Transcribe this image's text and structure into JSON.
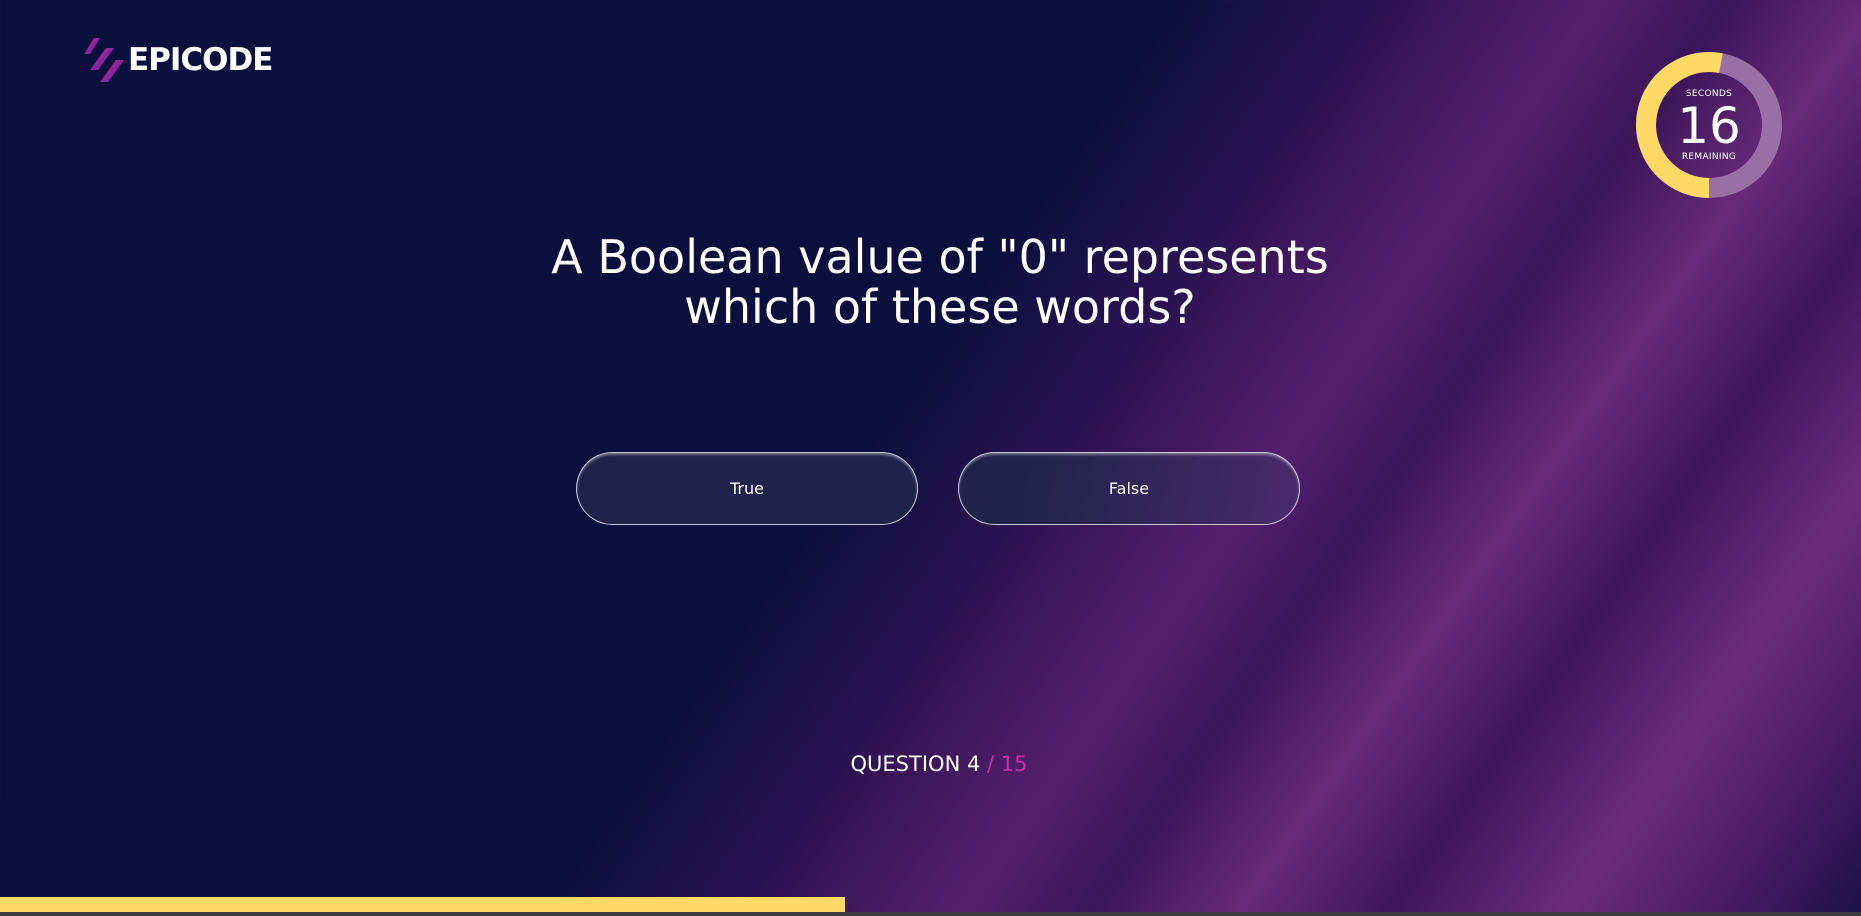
{
  "header": {
    "brand_name": "EPICODE",
    "logo_icon": "epicode-stripes-logo"
  },
  "timer": {
    "caption_top": "SECONDS",
    "value": "16",
    "caption_bottom": "REMAINING",
    "remaining_fraction": 0.53,
    "colors": {
      "remaining": "#ffd966",
      "elapsed": "#9a6fa6"
    }
  },
  "question": {
    "text": "A Boolean value of \"0\" represents which of these words?"
  },
  "answers": [
    {
      "label": "True"
    },
    {
      "label": "False"
    }
  ],
  "progress": {
    "question_label": "QUESTION 4",
    "total_label": "/ 15",
    "current": 4,
    "total": 15,
    "fill_fraction": 0.454
  },
  "colors": {
    "background": "#0b0f3d",
    "accent_yellow": "#ffd966",
    "accent_magenta": "#c62fa8"
  }
}
